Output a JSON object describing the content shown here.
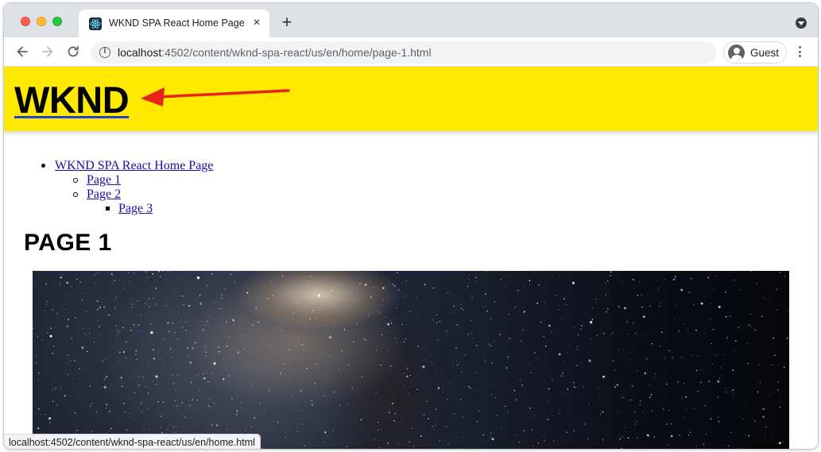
{
  "browser": {
    "tab": {
      "title": "WKND SPA React Home Page",
      "favicon": "react-favicon-icon"
    },
    "new_tab_label": "+",
    "close_tab_label": "×",
    "address_bar": {
      "host": "localhost",
      "path": ":4502/content/wknd-spa-react/us/en/home/page-1.html"
    },
    "profile": {
      "label": "Guest",
      "icon": "guest-avatar-icon"
    },
    "status_bar": {
      "text": "localhost:4502/content/wknd-spa-react/us/en/home.html"
    }
  },
  "site": {
    "header": {
      "logo": "WKND",
      "background": "#ffea00",
      "annotation_arrow_color": "#e8231b"
    },
    "navigation": {
      "root": "WKND SPA React Home Page",
      "children": [
        "Page 1",
        "Page 2"
      ],
      "grandchildren": [
        "Page 3"
      ]
    },
    "page_title": "PAGE 1",
    "hero_image": "milky-way-night-sky-image"
  }
}
